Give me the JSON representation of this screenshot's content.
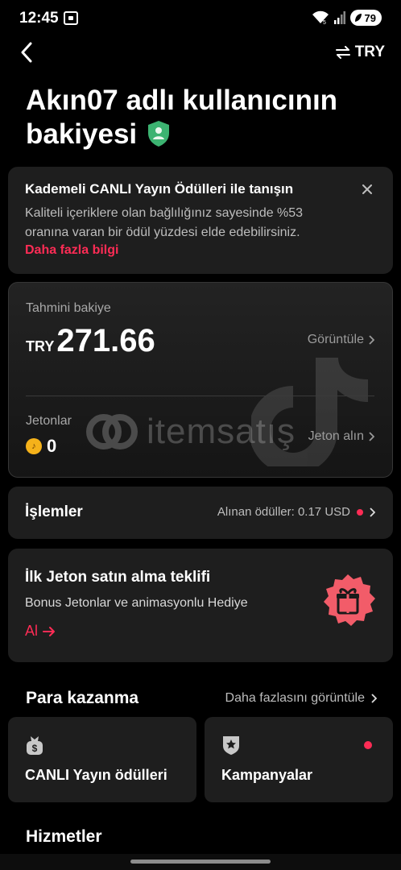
{
  "status_bar": {
    "time": "12:45",
    "battery": "79",
    "icons": [
      "screen-record-icon",
      "wifi-icon",
      "signal-icon",
      "battery-icon"
    ]
  },
  "nav": {
    "back_icon": "chevron-left-icon",
    "currency_label": "TRY",
    "currency_icon": "swap-arrows-icon"
  },
  "title": {
    "line1": "Akın07 adlı kullanıcının",
    "line2": "bakiyesi",
    "badge_icon": "shield-user-icon"
  },
  "promo": {
    "title": "Kademeli CANLI Yayın Ödülleri ile tanışın",
    "body": "Kaliteli içeriklere olan bağlılığınız sayesinde %53 oranına varan bir ödül yüzdesi elde edebilirsiniz.",
    "link": "Daha fazla bilgi"
  },
  "balance": {
    "label": "Tahmini bakiye",
    "currency": "TRY",
    "value": "271.66",
    "view_link": "Görüntüle",
    "coins_label": "Jetonlar",
    "coins_value": "0",
    "buy_link": "Jeton alın",
    "watermark": "itemsatış"
  },
  "transactions": {
    "title": "İşlemler",
    "summary": "Alınan ödüller: 0.17 USD"
  },
  "offer": {
    "title": "İlk Jeton satın alma teklifi",
    "desc": "Bonus Jetonlar ve animasyonlu Hediye",
    "link": "Al"
  },
  "monetization": {
    "title": "Para kazanma",
    "more_link": "Daha fazlasını görüntüle",
    "tiles": [
      {
        "label": "CANLI Yayın ödülleri",
        "icon": "money-bag-icon"
      },
      {
        "label": "Kampanyalar",
        "icon": "star-badge-icon",
        "has_dot": true
      }
    ]
  },
  "services": {
    "title": "Hizmetler"
  },
  "colors": {
    "accent": "#fe2c55",
    "card": "#1e1e1e",
    "shield": "#3cb371"
  }
}
